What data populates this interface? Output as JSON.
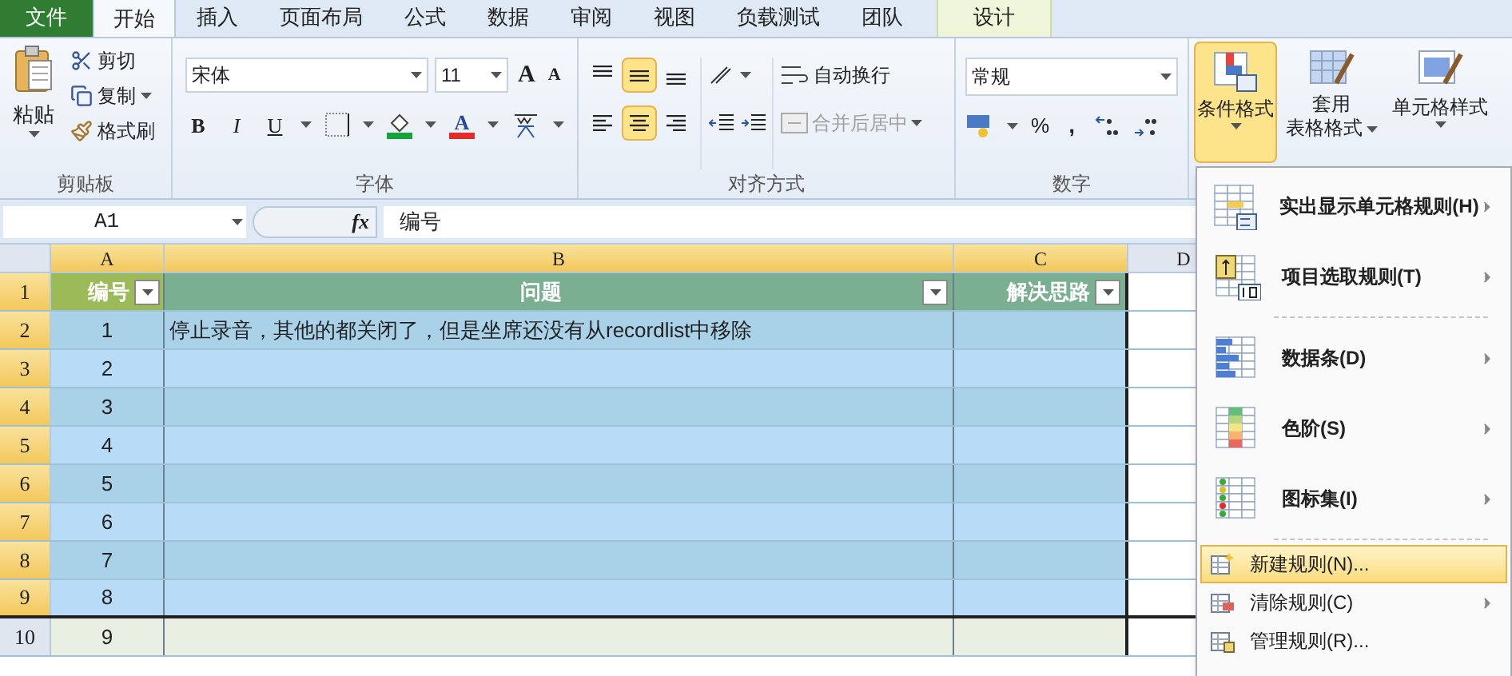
{
  "tabs": [
    {
      "label": "文件",
      "kind": "file",
      "selected": false
    },
    {
      "label": "开始",
      "kind": "normal",
      "selected": true
    },
    {
      "label": "插入",
      "kind": "normal",
      "selected": false
    },
    {
      "label": "页面布局",
      "kind": "normal",
      "selected": false
    },
    {
      "label": "公式",
      "kind": "normal",
      "selected": false
    },
    {
      "label": "数据",
      "kind": "normal",
      "selected": false
    },
    {
      "label": "审阅",
      "kind": "normal",
      "selected": false
    },
    {
      "label": "视图",
      "kind": "normal",
      "selected": false
    },
    {
      "label": "负载测试",
      "kind": "normal",
      "selected": false
    },
    {
      "label": "团队",
      "kind": "normal",
      "selected": false
    },
    {
      "label": "设计",
      "kind": "context",
      "selected": false
    }
  ],
  "clipboard": {
    "paste": "粘贴",
    "cut": "剪切",
    "copy": "复制",
    "format_painter": "格式刷",
    "label": "剪贴板"
  },
  "font": {
    "name": "宋体",
    "size": "11",
    "grow": "A",
    "shrink": "A",
    "bold": "B",
    "italic": "I",
    "underline": "U",
    "font_color": "A",
    "label": "字体"
  },
  "alignment": {
    "vertical": [
      {
        "kind": "top",
        "selected": false
      },
      {
        "kind": "middle",
        "selected": true
      },
      {
        "kind": "bottom",
        "selected": false
      }
    ],
    "horizontal": [
      {
        "kind": "left",
        "selected": false
      },
      {
        "kind": "center",
        "selected": true
      },
      {
        "kind": "right",
        "selected": false
      }
    ],
    "wrap": "自动换行",
    "merge": {
      "label": "合并后居中",
      "disabled": true
    },
    "label": "对齐方式"
  },
  "number": {
    "format": "常规",
    "percent": "%",
    "comma": ",",
    "label": "数字"
  },
  "styles": {
    "conditional": {
      "label": "条件格式",
      "selected": true
    },
    "table_line1": "套用",
    "table_line2": "表格格式",
    "cell_styles": "单元格样式"
  },
  "formula_bar": {
    "name_box": "A1",
    "fx": "fx",
    "value": "编号"
  },
  "columns": [
    "A",
    "B",
    "C",
    "D"
  ],
  "row_numbers": [
    "1",
    "2",
    "3",
    "4",
    "5",
    "6",
    "7",
    "8",
    "9",
    "10"
  ],
  "table": {
    "headers": [
      "编号",
      "问题",
      "解决思路"
    ],
    "rows": [
      [
        "1",
        "停止录音，其他的都关闭了，但是坐席还没有从recordlist中移除"
      ],
      [
        "2"
      ],
      [
        "3"
      ],
      [
        "4"
      ],
      [
        "5"
      ],
      [
        "6"
      ],
      [
        "7"
      ],
      [
        "8"
      ]
    ]
  },
  "extra_row": [
    "9"
  ],
  "menu": [
    {
      "kind": "big",
      "label": "实出显示单元格规则(H)",
      "submenu": true,
      "selected": false
    },
    {
      "kind": "big",
      "label": "项目选取规则(T)",
      "submenu": true,
      "selected": false
    },
    {
      "kind": "separator"
    },
    {
      "kind": "big",
      "label": "数据条(D)",
      "submenu": true,
      "selected": false
    },
    {
      "kind": "big",
      "label": "色阶(S)",
      "submenu": true,
      "selected": false
    },
    {
      "kind": "big",
      "label": "图标集(I)",
      "submenu": true,
      "selected": false
    },
    {
      "kind": "separator"
    },
    {
      "kind": "small",
      "label": "新建规则(N)...",
      "submenu": false,
      "selected": true
    },
    {
      "kind": "small",
      "label": "清除规则(C)",
      "submenu": true,
      "selected": false
    },
    {
      "kind": "small",
      "label": "管理规则(R)...",
      "submenu": false,
      "selected": false
    }
  ]
}
